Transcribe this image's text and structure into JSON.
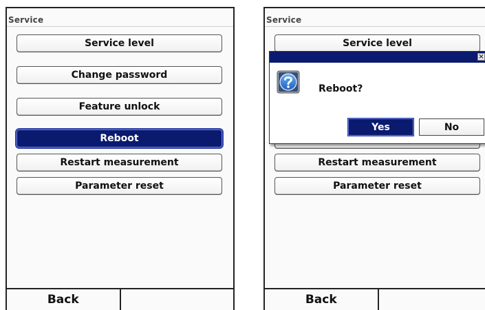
{
  "left_screen": {
    "title": "Service",
    "menu": [
      {
        "label": "Service level"
      },
      {
        "label": "Change password"
      },
      {
        "label": "Feature unlock"
      },
      {
        "label": "Reboot",
        "selected": true
      },
      {
        "label": "Restart measurement"
      },
      {
        "label": "Parameter reset"
      }
    ],
    "softkeys": {
      "left": "Back",
      "right": ""
    }
  },
  "right_screen": {
    "title": "Service",
    "menu": [
      {
        "label": "Service level"
      },
      {
        "label": "Restart measurement"
      },
      {
        "label": "Parameter reset"
      }
    ],
    "dialog": {
      "message": "Reboot?",
      "icon": "question-icon",
      "close_glyph": "×",
      "yes_label": "Yes",
      "no_label": "No"
    },
    "softkeys": {
      "left": "Back",
      "right": ""
    }
  },
  "colors": {
    "selection": "#0a1a6e",
    "dialog_titlebar": "#0a1a6e",
    "icon_blue": "#1f6fd1"
  }
}
